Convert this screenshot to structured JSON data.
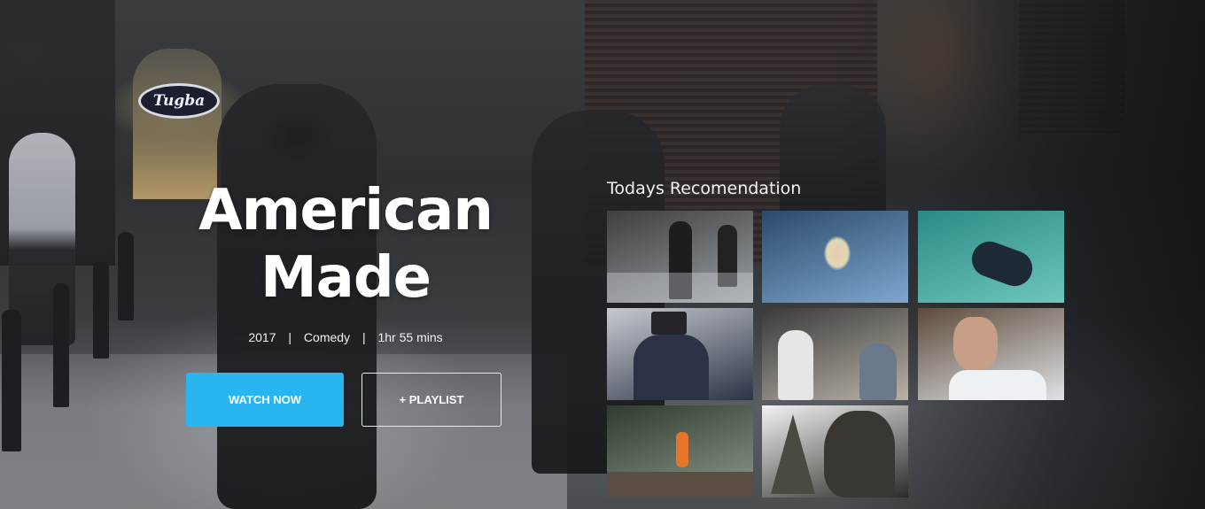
{
  "hero": {
    "background_sign_text": "Tugba",
    "title_line1": "American",
    "title_line2": "Made",
    "year": "2017",
    "genre": "Comedy",
    "duration": "1hr 55 mins",
    "separator": "|"
  },
  "actions": {
    "watch_label": "WATCH NOW",
    "playlist_label": "+ PLAYLIST",
    "accent_color": "#29b6f0"
  },
  "recommendations": {
    "heading": "Todays Recomendation",
    "tiles": [
      {
        "name": "street-walkers",
        "colors": [
          "#3d3f40",
          "#9aa0a4"
        ]
      },
      {
        "name": "blonde-woman-glass",
        "colors": [
          "#2a4a6a",
          "#7fa7cf"
        ]
      },
      {
        "name": "woman-underwater",
        "colors": [
          "#2b8a86",
          "#6fc6bd"
        ]
      },
      {
        "name": "man-top-hat",
        "colors": [
          "#c7cbd0",
          "#2c3246"
        ]
      },
      {
        "name": "two-girls-teddy",
        "colors": [
          "#3a3a3a",
          "#b9b2a6"
        ]
      },
      {
        "name": "man-on-pillow",
        "colors": [
          "#5c4a3a",
          "#dfe3e6"
        ]
      },
      {
        "name": "hiker-orange-jacket",
        "colors": [
          "#2f3b2f",
          "#8c998a"
        ]
      },
      {
        "name": "bearded-man-forest",
        "colors": [
          "#f3f3f3",
          "#2c2b28"
        ]
      }
    ]
  }
}
